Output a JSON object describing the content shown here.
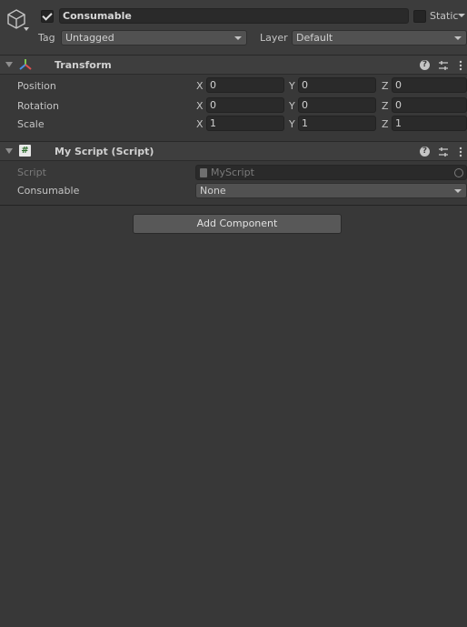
{
  "header": {
    "object_name": "Consumable",
    "active": true,
    "static_label": "Static",
    "static_checked": false,
    "tag_label": "Tag",
    "tag_value": "Untagged",
    "layer_label": "Layer",
    "layer_value": "Default",
    "icon": "cube-icon"
  },
  "transform": {
    "title": "Transform",
    "rows": [
      {
        "label": "Position",
        "x": "0",
        "y": "0",
        "z": "0"
      },
      {
        "label": "Rotation",
        "x": "0",
        "y": "0",
        "z": "0"
      },
      {
        "label": "Scale",
        "x": "1",
        "y": "1",
        "z": "1"
      }
    ],
    "axis": {
      "x": "X",
      "y": "Y",
      "z": "Z"
    }
  },
  "script_component": {
    "title": "My Script (Script)",
    "script_label": "Script",
    "script_value": "MyScript",
    "consumable_label": "Consumable",
    "consumable_value": "None"
  },
  "add_component_label": "Add Component",
  "colors": {
    "background": "#383838",
    "header": "#3c3c3c",
    "field": "#2a2a2a"
  }
}
